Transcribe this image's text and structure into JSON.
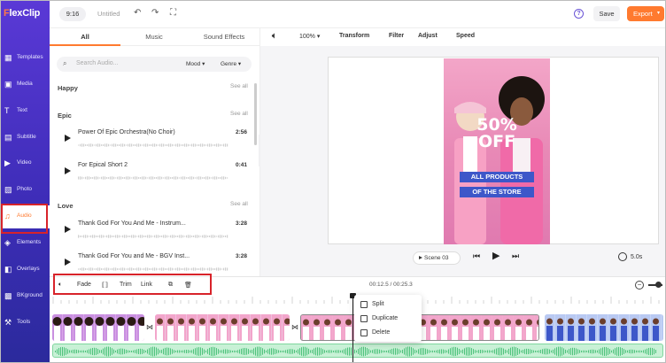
{
  "app": {
    "logo": "FlexClip",
    "aspect_ratio": "9:16",
    "project_title": "Untitled",
    "save_label": "Save",
    "export_label": "Export",
    "help_label": "?"
  },
  "sidebar": {
    "items": [
      {
        "label": "Templates",
        "icon": "templates-icon",
        "glyph": "▦"
      },
      {
        "label": "Media",
        "icon": "media-icon",
        "glyph": "▣"
      },
      {
        "label": "Text",
        "icon": "text-icon",
        "glyph": "T"
      },
      {
        "label": "Subtitle",
        "icon": "subtitle-icon",
        "glyph": "▤"
      },
      {
        "label": "Video",
        "icon": "video-icon",
        "glyph": "▶"
      },
      {
        "label": "Photo",
        "icon": "photo-icon",
        "glyph": "▨"
      },
      {
        "label": "Audio",
        "icon": "audio-icon",
        "glyph": "♫",
        "active": true
      },
      {
        "label": "Elements",
        "icon": "elements-icon",
        "glyph": "◈"
      },
      {
        "label": "Overlays",
        "icon": "overlays-icon",
        "glyph": "◧"
      },
      {
        "label": "BKground",
        "icon": "background-icon",
        "glyph": "▩"
      },
      {
        "label": "Tools",
        "icon": "tools-icon",
        "glyph": "⚒"
      }
    ]
  },
  "audio_panel": {
    "tabs": [
      "All",
      "Music",
      "Sound Effects"
    ],
    "active_tab": "All",
    "search_placeholder": "Search Audio...",
    "mood_label": "Mood",
    "genre_label": "Genre",
    "see_all": "See all",
    "sections": [
      {
        "title": "Happy",
        "tracks": []
      },
      {
        "title": "Epic",
        "tracks": [
          {
            "name": "Power Of Epic Orchestra(No Choir)",
            "duration": "2:56"
          },
          {
            "name": "For Epical Short 2",
            "duration": "0:41"
          }
        ]
      },
      {
        "title": "Love",
        "tracks": [
          {
            "name": "Thank God For You And Me - Instrum...",
            "duration": "3:28"
          },
          {
            "name": "Thank God For You and Me - BGV Inst...",
            "duration": "3:28"
          }
        ]
      }
    ]
  },
  "edit_toolbar": {
    "volume_icon": "volume-icon",
    "zoom": "100%",
    "items": [
      "Transform",
      "Filter",
      "Adjust",
      "Speed"
    ]
  },
  "preview": {
    "promo_line1": "50%",
    "promo_line2": "OFF",
    "banner1": "ALL PRODUCTS",
    "banner2": "OF THE STORE",
    "scene_label": "Scene 03",
    "duration": "5.0s"
  },
  "timeline": {
    "tools": [
      "Fade",
      "Trim",
      "Link"
    ],
    "timecode": "00:12.5 / 00:25.3",
    "context_menu": [
      "Split",
      "Duplicate",
      "Delete"
    ]
  },
  "colors": {
    "accent": "#ff7a2f",
    "sidebar": "#4b34c9",
    "highlight_box": "#d8232a",
    "audio_track": "#c8f1d6"
  }
}
